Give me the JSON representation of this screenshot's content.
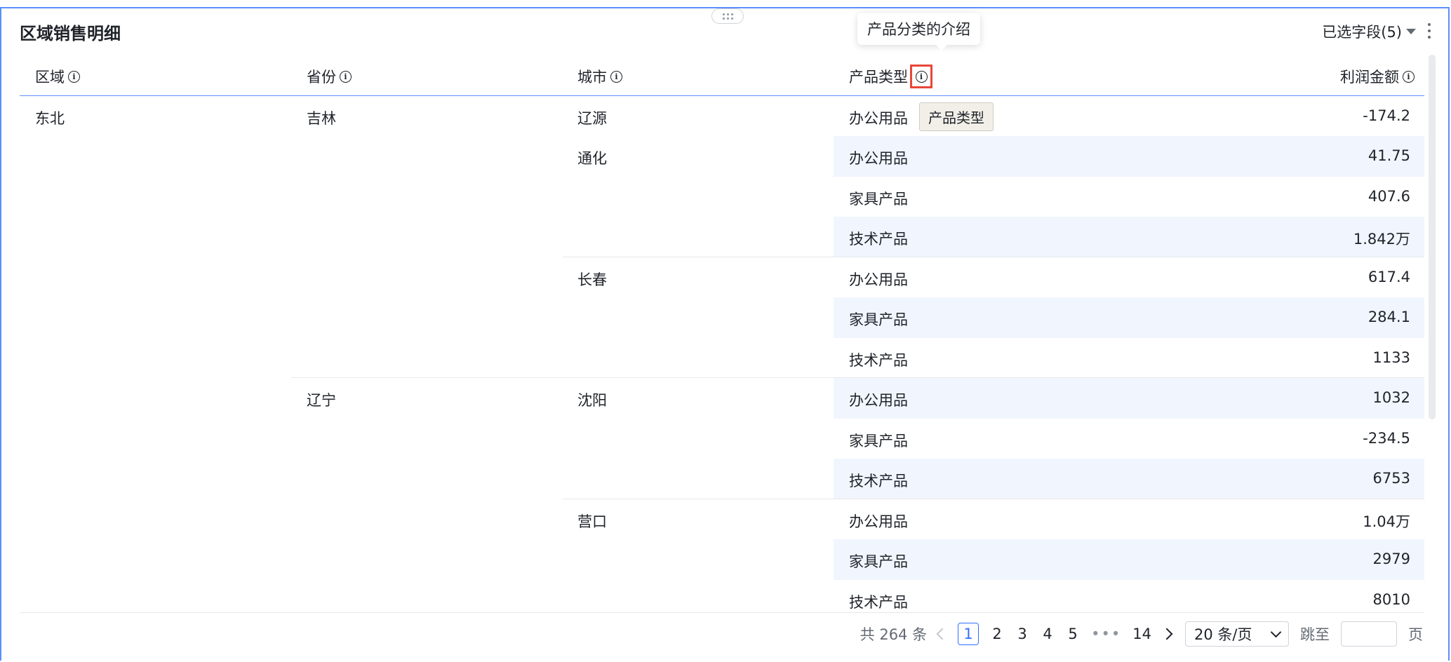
{
  "title": "区域销售明细",
  "fields_selector": "已选字段(5)",
  "header_tooltip": "产品分类的介绍",
  "cell_tooltip": "产品类型",
  "columns": [
    {
      "label": "区域"
    },
    {
      "label": "省份"
    },
    {
      "label": "城市"
    },
    {
      "label": "产品类型"
    },
    {
      "label": "利润金额"
    }
  ],
  "region": "东北",
  "provinces": [
    "吉林",
    "辽宁"
  ],
  "cities": [
    "辽源",
    "通化",
    "长春",
    "沈阳",
    "营口"
  ],
  "rows": [
    {
      "type": "办公用品",
      "profit": "-174.2"
    },
    {
      "type": "办公用品",
      "profit": "41.75"
    },
    {
      "type": "家具产品",
      "profit": "407.6"
    },
    {
      "type": "技术产品",
      "profit": "1.842万"
    },
    {
      "type": "办公用品",
      "profit": "617.4"
    },
    {
      "type": "家具产品",
      "profit": "284.1"
    },
    {
      "type": "技术产品",
      "profit": "1133"
    },
    {
      "type": "办公用品",
      "profit": "1032"
    },
    {
      "type": "家具产品",
      "profit": "-234.5"
    },
    {
      "type": "技术产品",
      "profit": "6753"
    },
    {
      "type": "办公用品",
      "profit": "1.04万"
    },
    {
      "type": "家具产品",
      "profit": "2979"
    },
    {
      "type": "技术产品",
      "profit": "8010"
    }
  ],
  "pagination": {
    "total": "共 264 条",
    "pages": [
      "1",
      "2",
      "3",
      "4",
      "5"
    ],
    "ellipsis": "•••",
    "last_page": "14",
    "page_size": "20 条/页",
    "jump_label": "跳至",
    "page_suffix": "页"
  }
}
